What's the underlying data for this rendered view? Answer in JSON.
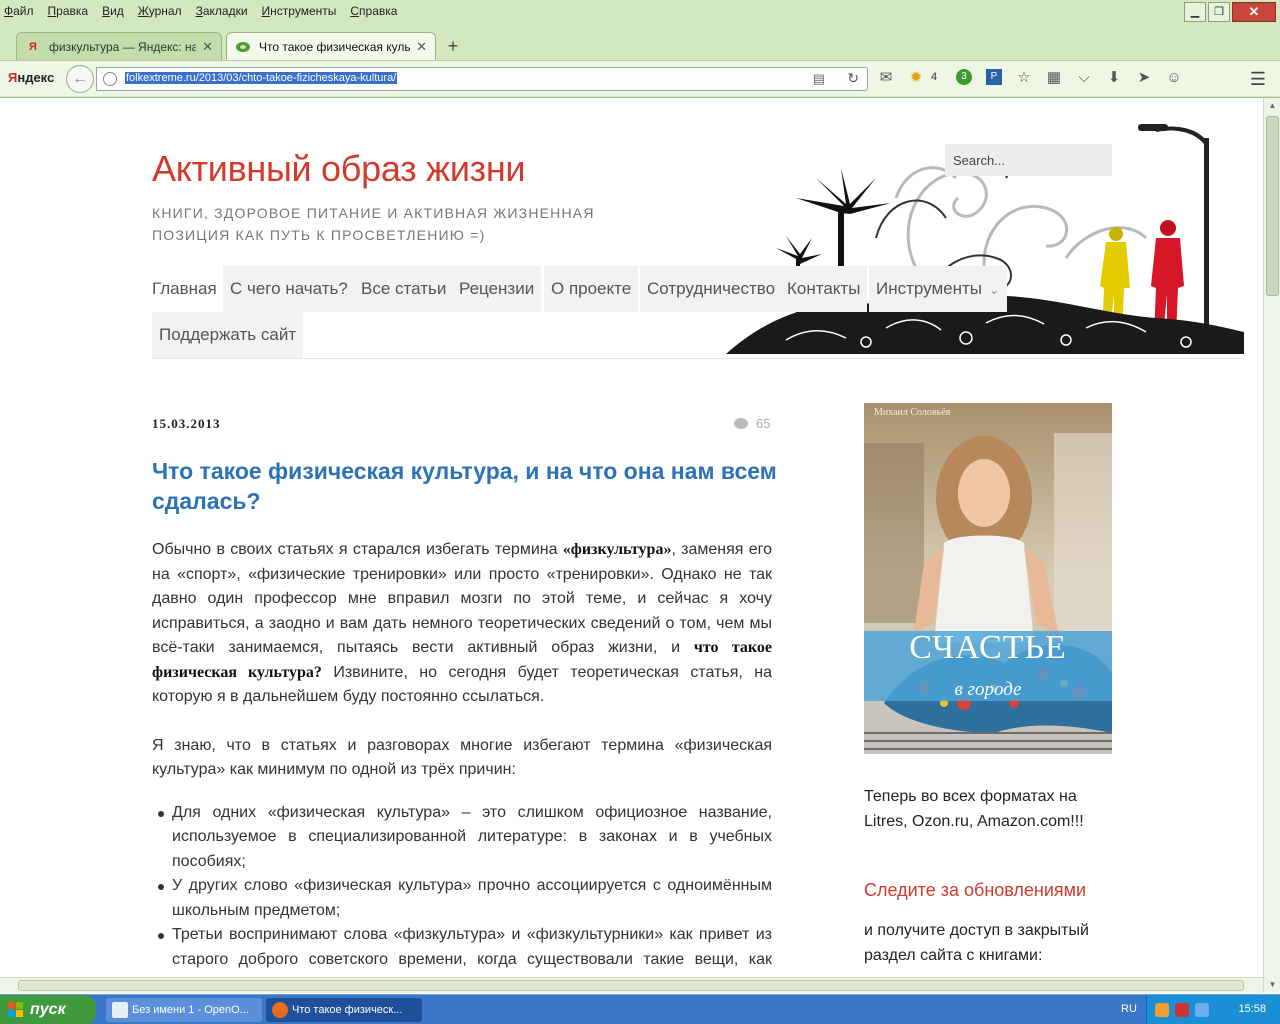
{
  "browser": {
    "menu": [
      "Файл",
      "Правка",
      "Вид",
      "Журнал",
      "Закладки",
      "Инструменты",
      "Справка"
    ],
    "tabs": [
      {
        "title": "физкультура — Яндекс: на...",
        "favicon": "yandex-icon",
        "active": false
      },
      {
        "title": "Что такое физическая культ...",
        "favicon": "leaf-icon",
        "active": true
      }
    ],
    "yandex_label": "Яндекс",
    "url": "folkextreme.ru/2013/03/chto-takoe-fizicheskaya-kultura/",
    "weather_count": "4",
    "badge_green": "3"
  },
  "site": {
    "title": "Активный образ жизни",
    "tagline": "Книги, здоровое питание и активная жизненная позиция как путь к просветлению =)",
    "search_placeholder": "Search...",
    "nav": [
      "Главная",
      "С чего начать?",
      "Все статьи",
      "Рецензии",
      "О проекте",
      "Сотрудничество",
      "Контакты",
      "Инструменты",
      "Поддержать сайт"
    ],
    "dropdown_glyph": "⌄"
  },
  "post": {
    "date": "15.03.2013",
    "comment_count": "65",
    "title": "Что такое физическая культура, и на что она нам всем сдалась?",
    "p1_a": "Обычно в своих статьях я старался избегать термина ",
    "p1_b": "«физкультура»",
    "p1_c": ", заменяя его на «спорт», «физические тренировки» или просто «тренировки». Однако не так давно один профессор мне вправил мозги по этой теме, и сейчас я хочу исправиться, а заодно и вам дать немного теоретических сведений о том, чем мы всё-таки занимаемся, пытаясь вести активный образ жизни, и ",
    "p1_d": "что такое физическая культура?",
    "p1_e": " Извините, но сегодня будет теоретическая статья, на которую я в дальнейшем буду постоянно ссылаться.",
    "p2": "Я знаю, что в статьях и разговорах многие избегают термина «физическая культура» как минимум по одной из трёх причин:",
    "bullets": [
      "Для одних «физическая культура» – это слишком официозное название, используемое в специализированной литературе: в законах и в учебных пособиях;",
      "У других слово «физическая культура» прочно ассоциируется с одноимённым школьным предметом;",
      "Третьи воспринимают слова «физкультура» и «физкультурники» как привет из старого доброго советского времени, когда существовали такие вещи, как нормативы ГТО и спартакиады, а словом «спортсмен» называли не только тех,"
    ]
  },
  "sidebar": {
    "book_author": "Михаил Соловьёв",
    "book_title": "СЧАСТЬЕ",
    "book_subtitle": "в городе",
    "formats_text": "Теперь во всех форматах на Litres, Ozon.ru, Amazon.com!!!",
    "subscribe_heading": "Следите за обновлениями",
    "subscribe_text": "и получите доступ в закрытый раздел сайта с книгами:"
  },
  "taskbar": {
    "start_label": "пуск",
    "tasks": [
      "Без имени 1 - OpenO...",
      "Что такое физическ..."
    ],
    "lang": "RU",
    "time": "15:58"
  },
  "colors": {
    "accent_red": "#d33a2c",
    "link_blue": "#2b72b8",
    "chrome_green": "#d4e8bf",
    "taskbar_blue": "#3b77c8"
  }
}
